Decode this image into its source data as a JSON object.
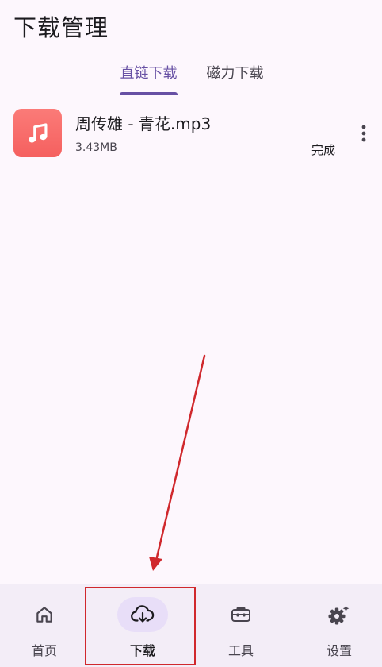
{
  "header": {
    "title": "下载管理"
  },
  "tabs": [
    {
      "label": "直链下载",
      "active": true
    },
    {
      "label": "磁力下载",
      "active": false
    }
  ],
  "downloads": [
    {
      "name": "周传雄 - 青花.mp3",
      "size": "3.43MB",
      "status": "完成",
      "icon": "music-note-icon"
    }
  ],
  "bottom_nav": {
    "items": [
      {
        "label": "首页",
        "icon": "home-icon",
        "active": false
      },
      {
        "label": "下载",
        "icon": "cloud-download-icon",
        "active": true
      },
      {
        "label": "工具",
        "icon": "toolbox-icon",
        "active": false
      },
      {
        "label": "设置",
        "icon": "settings-icon",
        "active": false
      }
    ]
  },
  "colors": {
    "accent": "#6750a4",
    "thumb": "#f96b69",
    "nav_bg": "#f3edf7",
    "nav_active": "#e8def8",
    "annotation": "#d0282d"
  }
}
